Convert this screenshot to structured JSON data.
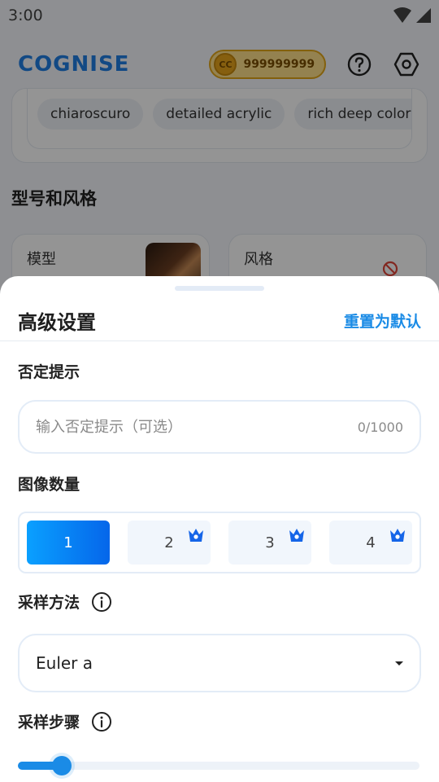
{
  "status_bar": {
    "time": "3:00"
  },
  "header": {
    "logo": "COGNISE",
    "coin_label": "CC",
    "coin_count": "999999999",
    "help_icon": "help-circle-icon",
    "settings_icon": "hexagon-settings-icon"
  },
  "background": {
    "tags": [
      "chiaroscuro",
      "detailed acrylic",
      "rich deep colors"
    ],
    "section_title": "型号和风格",
    "model_label": "模型",
    "style_label": "风格"
  },
  "sheet": {
    "title": "高级设置",
    "reset_label": "重置为默认",
    "negative_prompt": {
      "label": "否定提示",
      "placeholder": "输入否定提示（可选）",
      "value": "",
      "counter": "0/1000"
    },
    "image_count": {
      "label": "图像数量",
      "options": [
        "1",
        "2",
        "3",
        "4"
      ],
      "selected": "1"
    },
    "sampler": {
      "label": "采样方法",
      "value": "Euler a"
    },
    "steps": {
      "label": "采样步骤",
      "value_fraction": 0.09
    }
  },
  "colors": {
    "accent": "#1a8be6",
    "coin_border": "#e2a618",
    "logo": "#1f7fe3"
  }
}
